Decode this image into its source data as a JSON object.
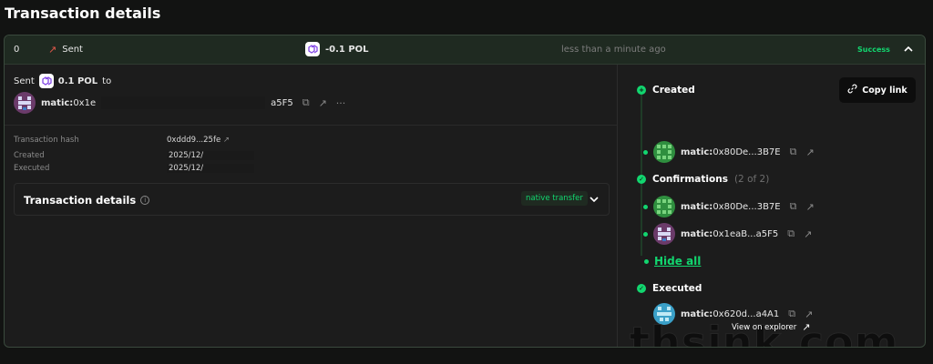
{
  "page": {
    "title": "Transaction details"
  },
  "header": {
    "nonce": "0",
    "type_label": "Sent",
    "amount": "-0.1 POL",
    "time": "less than a minute ago",
    "status": "Success"
  },
  "summary": {
    "sent_label": "Sent",
    "amount": "0.1 POL",
    "to_label": "to",
    "recipient_prefix": "matic:",
    "recipient_start": "0x1e",
    "recipient_end": "a5F5",
    "more": "···"
  },
  "info": {
    "hash_label": "Transaction hash",
    "hash_value": "0xddd9...25fe",
    "created_label": "Created",
    "created_value": "2025/12/",
    "executed_label": "Executed",
    "executed_value": "2025/12/"
  },
  "details": {
    "title": "Transaction details",
    "badge": "native transfer"
  },
  "timeline": {
    "created_label": "Created",
    "created_prefix": "matic:",
    "created_addr": "0x80De...3B7E",
    "confirmations_label": "Confirmations",
    "confirmations_count": "(2 of 2)",
    "conf1_prefix": "matic:",
    "conf1_addr": "0x80De...3B7E",
    "conf2_prefix": "matic:",
    "conf2_addr": "0x1eaB...a5F5",
    "hide_all": "Hide all",
    "executed_label": "Executed",
    "executed_prefix": "matic:",
    "executed_addr": "0x620d...a4A1",
    "copy_link": "Copy link",
    "view_explorer": "View on explorer"
  },
  "watermark": "thsink.com",
  "colors": {
    "accent": "#12d66f",
    "sent_arrow": "#e0584a",
    "header_bg": "#1f2a21"
  },
  "icons": [
    "sent-arrow-icon",
    "pol-token-icon",
    "chevron-up-icon",
    "copy-icon",
    "external-link-icon",
    "more-icon",
    "info-icon",
    "chevron-down-icon",
    "plus-circle-icon",
    "check-circle-icon",
    "link-icon"
  ]
}
